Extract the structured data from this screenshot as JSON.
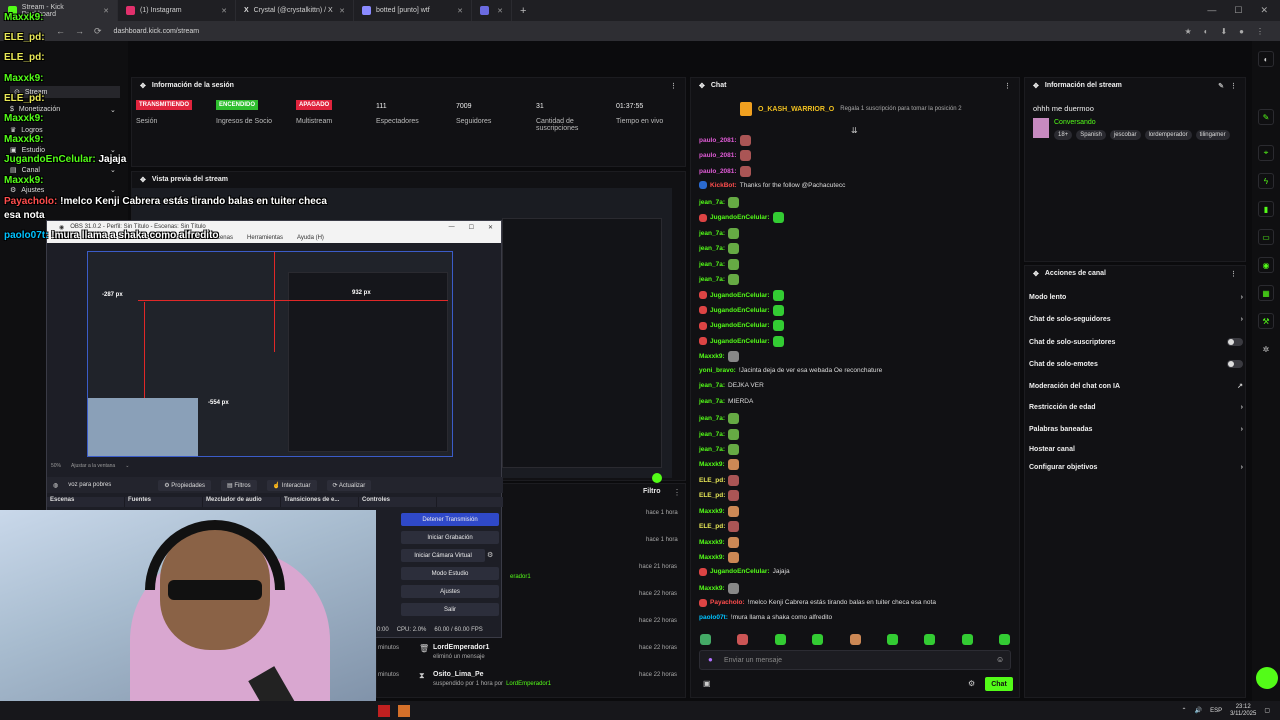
{
  "browser": {
    "tabs": [
      {
        "label": "Stream - Kick Dashboard",
        "color": "#53fc18"
      },
      {
        "label": "(1) Instagram",
        "color": "#e1306c"
      },
      {
        "label": "Crystal (@crystalkittn) / X",
        "color": "#cccccc"
      },
      {
        "label": "botted [punto] wtf",
        "color": "#8a8aff"
      }
    ],
    "url": "dashboard.kick.com/stream"
  },
  "nav": {
    "items": [
      "Stream",
      "Monetización",
      "Logros",
      "Estudio",
      "Canal",
      "Ajustes"
    ]
  },
  "overlay_chat": [
    {
      "user": "Maxxk9:",
      "text": "",
      "color": "#53fc18"
    },
    {
      "user": "ELE_pd:",
      "text": "",
      "color": "#e8e857"
    },
    {
      "user": "ELE_pd:",
      "text": "",
      "color": "#e8e857"
    },
    {
      "user": "Maxxk9:",
      "text": "",
      "color": "#53fc18"
    },
    {
      "user": "ELE_pd:",
      "text": "",
      "color": "#e8e857"
    },
    {
      "user": "Maxxk9:",
      "text": "",
      "color": "#53fc18"
    },
    {
      "user": "Maxxk9:",
      "text": "",
      "color": "#53fc18"
    },
    {
      "user": "JugandoEnCelular:",
      "text": "Jajaja",
      "color": "#53fc18"
    },
    {
      "user": "Maxxk9:",
      "text": "",
      "color": "#53fc18"
    },
    {
      "user": "Payacholo:",
      "text": "!melco Kenji Cabrera estás tirando balas en tuiter checa esa nota",
      "color": "#ff4d4d"
    },
    {
      "user": "paolo07t:",
      "text": "!mura llama a shaka como alfredito",
      "color": "#00c2ff"
    }
  ],
  "session": {
    "title": "Información de la sesión",
    "stats": [
      {
        "badge": "TRANSMITIENDO",
        "badge_color": "#e0243d",
        "label": "Sesión"
      },
      {
        "badge": "ENCENDIDO",
        "badge_color": "#2fbf2f",
        "label": "Ingresos de Socio"
      },
      {
        "badge": "APAGADO",
        "badge_color": "#e0243d",
        "label": "Multistream"
      },
      {
        "value": "111",
        "label": "Espectadores"
      },
      {
        "value": "7009",
        "label": "Seguidores"
      },
      {
        "value": "31",
        "label": "Cantidad de suscripciones"
      },
      {
        "value": "01:37:55",
        "label": "Tiempo en vivo"
      }
    ]
  },
  "preview": {
    "title": "Vista previa del stream"
  },
  "obs": {
    "title": "OBS 31.0.2 - Perfil: Sin Título - Escenas: Sin Título",
    "menu": [
      "Archivo",
      "Editar",
      "Vista",
      "Perfil",
      "Colección de Escenas",
      "Herramientas",
      "Ayuda (H)"
    ],
    "labels": {
      "w": "932 px",
      "h": "-554 px",
      "left": "-287 px"
    },
    "zoom": "50%",
    "zoom_label": "Ajustar a la ventana",
    "source": "voz para pobres",
    "toolbar": [
      "Propiedades",
      "Filtros",
      "Interactuar",
      "Actualizar"
    ],
    "docks": [
      "Escenas",
      "Fuentes",
      "Mezclador de audio",
      "Transiciones de e...",
      "Controles"
    ],
    "controls": [
      "Detener Transmisión",
      "Iniciar Grabación",
      "Iniciar Cámara Virtual",
      "Modo Estudio",
      "Ajustes",
      "Salir"
    ],
    "status": {
      "time": "0:00",
      "cpu": "CPU: 2.0%",
      "fps": "60.00 / 60.00 FPS"
    }
  },
  "modlog": {
    "filter": "Filtro",
    "times": [
      "hace 1 hora",
      "hace 1 hora",
      "hace 21 horas",
      "hace 22 horas",
      "hace 22 horas",
      "hace 22 horas",
      "hace 22 horas",
      "hace 22 horas"
    ],
    "entries": [
      {
        "user": "LordEmperador1",
        "action": "eliminó un mensaje"
      },
      {
        "user": "Osito_Lima_Pe",
        "action": "suspendido por 1 hora por",
        "by": "LordEmperador1"
      }
    ],
    "partial": [
      "erador1",
      "minutos",
      "minutos"
    ]
  },
  "chat": {
    "title": "Chat",
    "pinned_user": "O_KASH_WARRIOR_O",
    "pinned_note": "Regala 1 suscripción para tomar la posición 2",
    "messages": [
      {
        "user": "paulo_2081:",
        "text": "",
        "color": "#e05bd6",
        "emote": "#a55"
      },
      {
        "user": "paulo_2081:",
        "text": "",
        "color": "#e05bd6",
        "emote": "#a55"
      },
      {
        "user": "paulo_2081:",
        "text": "",
        "color": "#e05bd6",
        "emote": "#a55"
      },
      {
        "user": "KickBot:",
        "text": "Thanks for the follow @Pachacutecc",
        "color": "#ff4d4d",
        "emote": ""
      },
      {
        "user": "jean_7a:",
        "text": "",
        "color": "#53fc18",
        "emote": "#6a4"
      },
      {
        "user": "JugandoEnCelular:",
        "text": "",
        "color": "#53fc18",
        "emote": "#3c3"
      },
      {
        "user": "jean_7a:",
        "text": "",
        "color": "#53fc18",
        "emote": "#6a4"
      },
      {
        "user": "jean_7a:",
        "text": "",
        "color": "#53fc18",
        "emote": "#6a4"
      },
      {
        "user": "jean_7a:",
        "text": "",
        "color": "#53fc18",
        "emote": "#6a4"
      },
      {
        "user": "jean_7a:",
        "text": "",
        "color": "#53fc18",
        "emote": "#6a4"
      },
      {
        "user": "JugandoEnCelular:",
        "text": "",
        "color": "#53fc18",
        "emote": "#3c3"
      },
      {
        "user": "JugandoEnCelular:",
        "text": "",
        "color": "#53fc18",
        "emote": "#3c3"
      },
      {
        "user": "JugandoEnCelular:",
        "text": "",
        "color": "#53fc18",
        "emote": "#3c3"
      },
      {
        "user": "JugandoEnCelular:",
        "text": "",
        "color": "#53fc18",
        "emote": "#3c3"
      },
      {
        "user": "Maxxk9:",
        "text": "",
        "color": "#53fc18",
        "emote": "#888"
      },
      {
        "user": "yoni_bravo:",
        "text": "!Jacinta deja de ver esa webada Oe reconchature",
        "color": "#53fc18",
        "emote": ""
      },
      {
        "user": "jean_7a:",
        "text": "DEJKA VER",
        "color": "#53fc18",
        "emote": ""
      },
      {
        "user": "jean_7a:",
        "text": "MIERDA",
        "color": "#53fc18",
        "emote": ""
      },
      {
        "user": "jean_7a:",
        "text": "",
        "color": "#53fc18",
        "emote": "#6a4"
      },
      {
        "user": "jean_7a:",
        "text": "",
        "color": "#53fc18",
        "emote": "#6a4"
      },
      {
        "user": "jean_7a:",
        "text": "",
        "color": "#53fc18",
        "emote": "#6a4"
      },
      {
        "user": "Maxxk9:",
        "text": "",
        "color": "#53fc18",
        "emote": "#c85"
      },
      {
        "user": "ELE_pd:",
        "text": "",
        "color": "#e8e857",
        "emote": "#a55"
      },
      {
        "user": "ELE_pd:",
        "text": "",
        "color": "#e8e857",
        "emote": "#a55"
      },
      {
        "user": "Maxxk9:",
        "text": "",
        "color": "#53fc18",
        "emote": "#c85"
      },
      {
        "user": "ELE_pd:",
        "text": "",
        "color": "#e8e857",
        "emote": "#a55"
      },
      {
        "user": "Maxxk9:",
        "text": "",
        "color": "#53fc18",
        "emote": "#c85"
      },
      {
        "user": "Maxxk9:",
        "text": "",
        "color": "#53fc18",
        "emote": "#c85"
      },
      {
        "user": "JugandoEnCelular:",
        "text": "Jajaja",
        "color": "#53fc18",
        "emote": ""
      },
      {
        "user": "Maxxk9:",
        "text": "",
        "color": "#53fc18",
        "emote": "#888"
      },
      {
        "user": "Payacholo:",
        "text": "!melco Kenji Cabrera estás tirando balas en tuiter checa esa nota",
        "color": "#ff4d4d",
        "emote": ""
      },
      {
        "user": "paolo07t:",
        "text": "!mura llama a shaka como alfredito",
        "color": "#00c2ff",
        "emote": ""
      }
    ],
    "input_placeholder": "Enviar un mensaje",
    "send_label": "Chat"
  },
  "stream_info": {
    "title": "Información del stream",
    "stream_title": "ohhh me duermoo",
    "category": "Conversando",
    "tags": [
      "18+",
      "Spanish",
      "jescobar",
      "lordemperador",
      "tilingamer"
    ]
  },
  "channel_actions": {
    "title": "Acciones de canal",
    "items": [
      {
        "label": "Modo lento",
        "control": "chevron"
      },
      {
        "label": "Chat de solo-seguidores",
        "control": "chevron"
      },
      {
        "label": "Chat de solo-suscriptores",
        "control": "toggle"
      },
      {
        "label": "Chat de solo-emotes",
        "control": "toggle"
      },
      {
        "label": "Moderación del chat con IA",
        "control": "external"
      },
      {
        "label": "Restricción de edad",
        "control": "chevron"
      },
      {
        "label": "Palabras baneadas",
        "control": "chevron"
      },
      {
        "label": "Hostear canal",
        "control": "none"
      },
      {
        "label": "Configurar objetivos",
        "control": "chevron"
      }
    ]
  },
  "taskbar": {
    "lang": "ESP",
    "time": "23:12",
    "date": "3/11/2025"
  },
  "colors": {
    "kick_green": "#53fc18",
    "red": "#e0243d",
    "obs_blue": "#2f49c8"
  }
}
